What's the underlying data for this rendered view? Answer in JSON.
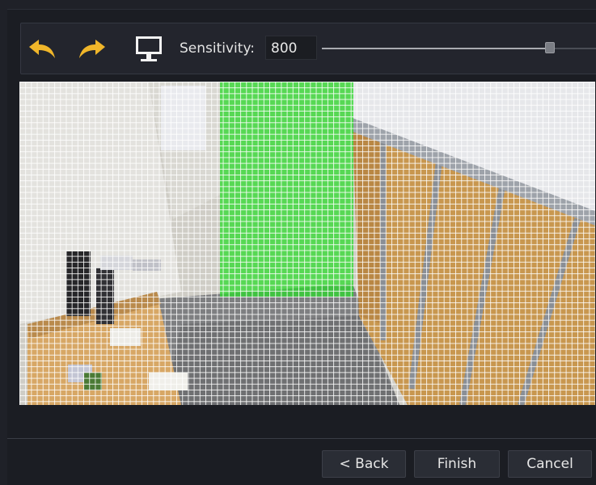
{
  "toolbar": {
    "undo_icon": "undo-arrow-icon",
    "redo_icon": "redo-arrow-icon",
    "monitor_icon": "monitor-icon",
    "sensitivity_label": "Sensitivity:",
    "sensitivity_value": "800",
    "slider_level": 0.83
  },
  "camera_view": {
    "grid": true,
    "selected_zone_color": "#28dc28"
  },
  "footer": {
    "back_label": "< Back",
    "finish_label": "Finish",
    "cancel_label": "Cancel"
  },
  "colors": {
    "accent": "#f0b62a",
    "background": "#1b1d23",
    "zone": "#2ee02e"
  }
}
